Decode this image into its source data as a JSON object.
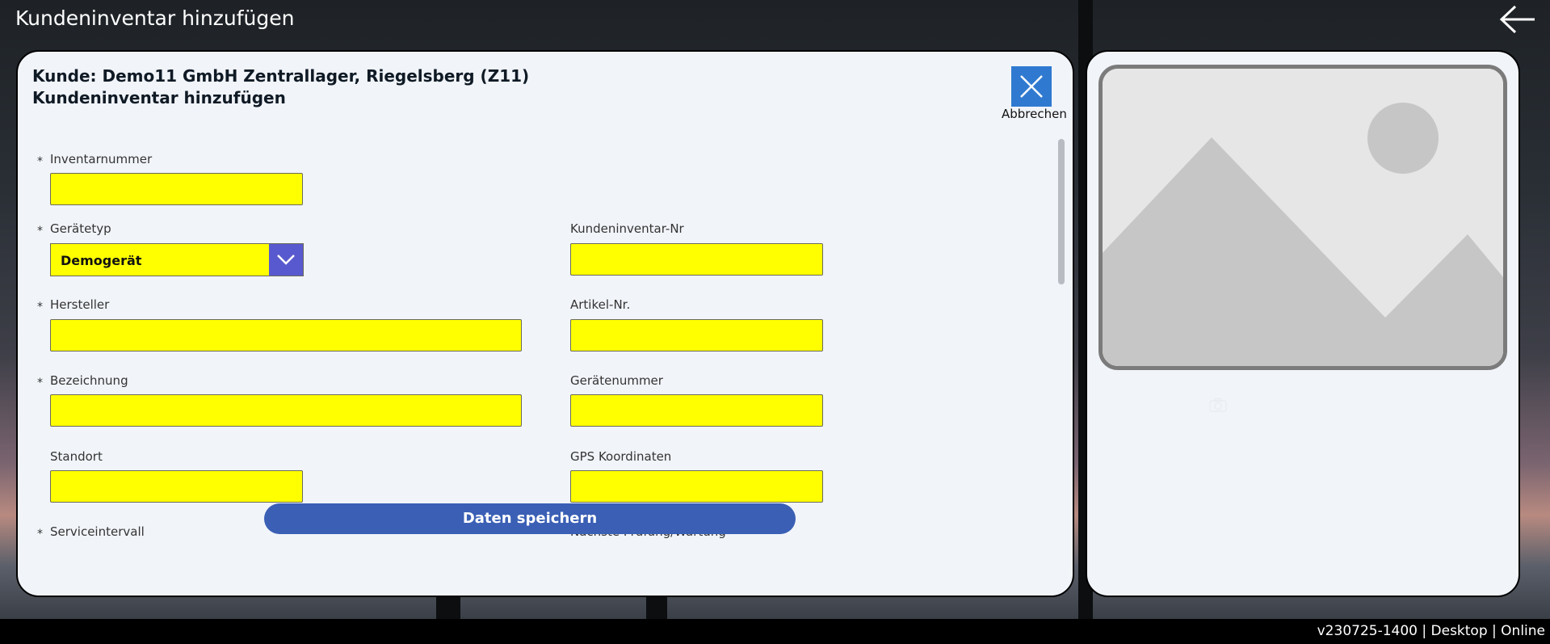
{
  "app": {
    "title": "Kundeninventar hinzufügen"
  },
  "form": {
    "customer_line": "Kunde: Demo11 GmbH Zentrallager, Riegelsberg (Z11)",
    "heading": "Kundeninventar hinzufügen",
    "cancel_label": "Abbrechen",
    "required_marker": "*",
    "fields": {
      "inventarnummer": {
        "label": "Inventarnummer",
        "value": ""
      },
      "geraetetyp": {
        "label": "Gerätetyp",
        "value": "Demogerät"
      },
      "kundeninventar_nr": {
        "label": "Kundeninventar-Nr",
        "value": ""
      },
      "hersteller": {
        "label": "Hersteller",
        "value": ""
      },
      "artikel_nr": {
        "label": "Artikel-Nr.",
        "value": ""
      },
      "bezeichnung": {
        "label": "Bezeichnung",
        "value": ""
      },
      "geraetenummer": {
        "label": "Gerätenummer",
        "value": ""
      },
      "standort": {
        "label": "Standort",
        "value": ""
      },
      "gps": {
        "label": "GPS Koordinaten",
        "value": ""
      },
      "serviceintervall": {
        "label": "Serviceintervall"
      },
      "naechste_pruefung": {
        "label": "Nächste Prüfung/Wartung"
      }
    },
    "save_label": "Daten speichern"
  },
  "status_bar": {
    "text": "v230725-1400 | Desktop | Online"
  },
  "colors": {
    "field_bg": "#ffff00",
    "primary_button": "#3a5fb5",
    "close_button": "#2f7ad0",
    "dropdown_chevron": "#5959cf",
    "panel_bg": "#f1f4f9"
  }
}
